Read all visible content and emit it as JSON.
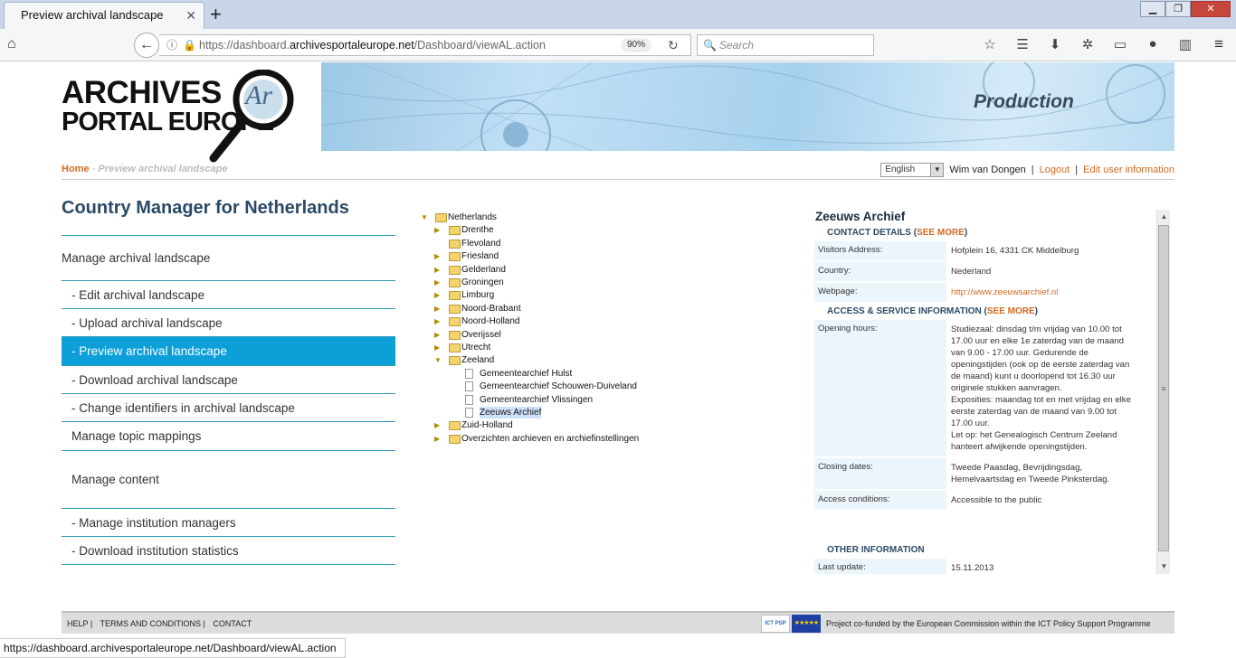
{
  "browser": {
    "tab_title": "Preview archival landscape",
    "tab_close": "✕",
    "new_tab": "+",
    "window_buttons": {
      "minimize": "▁",
      "restore": "❐",
      "close": "✕"
    },
    "url_prefix": "https://dashboard.",
    "url_domain": "archivesportaleurope.net",
    "url_path": "/Dashboard/viewAL.action",
    "zoom": "90%",
    "search_placeholder": "Search",
    "status_url": "https://dashboard.archivesportaleurope.net/Dashboard/viewAL.action"
  },
  "header": {
    "logo_line1": "ARCHIVES",
    "logo_line2": "PORTAL EUROPE",
    "logo_emblem_text": "Ar",
    "banner_title": "Production"
  },
  "breadcrumb": {
    "home": "Home",
    "separator": "-",
    "current": "Preview archival landscape"
  },
  "userbar": {
    "language": "English",
    "user_name": "Wim van Dongen",
    "sep": "|",
    "logout": "Logout",
    "edit_user": "Edit user information"
  },
  "left": {
    "title": "Country Manager for Netherlands",
    "nav": [
      {
        "label": "Manage archival landscape",
        "kind": "header",
        "height": 50
      },
      {
        "label": "- Edit archival landscape",
        "kind": "item",
        "height": 31
      },
      {
        "label": "- Upload archival landscape",
        "kind": "item",
        "height": 31
      },
      {
        "label": "- Preview archival landscape",
        "kind": "active",
        "height": 32
      },
      {
        "label": "- Download archival landscape",
        "kind": "item",
        "height": 31
      },
      {
        "label": "- Change identifiers in archival landscape",
        "kind": "item",
        "height": 31
      },
      {
        "label": "Manage topic mappings",
        "kind": "item",
        "height": 32
      },
      {
        "label": "Manage content",
        "kind": "item",
        "height": 64
      },
      {
        "label": "- Manage institution managers",
        "kind": "item",
        "height": 31
      },
      {
        "label": "- Download institution statistics",
        "kind": "item",
        "height": 32
      }
    ]
  },
  "tree": {
    "nodes": [
      {
        "label": "Netherlands",
        "type": "folder",
        "level": 0,
        "expanded": true
      },
      {
        "label": "Drenthe",
        "type": "folder",
        "level": 1,
        "expanded": false
      },
      {
        "label": "Flevoland",
        "type": "folder",
        "level": 1,
        "expanded": null
      },
      {
        "label": "Friesland",
        "type": "folder",
        "level": 1,
        "expanded": false
      },
      {
        "label": "Gelderland",
        "type": "folder",
        "level": 1,
        "expanded": false
      },
      {
        "label": "Groningen",
        "type": "folder",
        "level": 1,
        "expanded": false
      },
      {
        "label": "Limburg",
        "type": "folder",
        "level": 1,
        "expanded": false
      },
      {
        "label": "Noord-Brabant",
        "type": "folder",
        "level": 1,
        "expanded": false
      },
      {
        "label": "Noord-Holland",
        "type": "folder",
        "level": 1,
        "expanded": false
      },
      {
        "label": "Overijssel",
        "type": "folder",
        "level": 1,
        "expanded": false
      },
      {
        "label": "Utrecht",
        "type": "folder",
        "level": 1,
        "expanded": false
      },
      {
        "label": "Zeeland",
        "type": "folder",
        "level": 1,
        "expanded": true
      },
      {
        "label": "Gemeentearchief Hulst",
        "type": "doc",
        "level": 2
      },
      {
        "label": "Gemeentearchief Schouwen-Duiveland",
        "type": "doc",
        "level": 2
      },
      {
        "label": "Gemeentearchief Vlissingen",
        "type": "doc",
        "level": 2
      },
      {
        "label": "Zeeuws Archief",
        "type": "doc",
        "level": 2,
        "selected": true
      },
      {
        "label": "Zuid-Holland",
        "type": "folder",
        "level": 1,
        "expanded": false
      },
      {
        "label": "Overzichten archieven en archiefinstellingen",
        "type": "folder",
        "level": 1,
        "expanded": false
      }
    ]
  },
  "detail": {
    "title": "Zeeuws Archief",
    "contact_heading": "CONTACT DETAILS",
    "see_more": "SEE MORE",
    "contact_rows": [
      {
        "key": "Visitors Address:",
        "value": "Hofplein 16, 4331 CK Middelburg",
        "link": false
      },
      {
        "key": "Country:",
        "value": "Nederland",
        "link": false
      },
      {
        "key": "Webpage:",
        "value": "http://www.zeeuwsarchief.nl",
        "link": true
      }
    ],
    "access_heading": "ACCESS & SERVICE INFORMATION",
    "access_rows": [
      {
        "key": "Opening hours:",
        "value": "Studiezaal: dinsdag t/m vrijdag van 10.00 tot 17.00 uur en elke 1e zaterdag van de maand van 9.00 - 17.00 uur. Gedurende de openingstijden (ook op de eerste zaterdag van de maand) kunt u doorlopend tot 16.30 uur originele stukken aanvragen.\nExposities: maandag tot en met vrijdag en elke eerste zaterdag van de maand van 9.00 tot 17.00 uur.\nLet op: het Genealogisch Centrum Zeeland hanteert afwijkende openingstijden."
      },
      {
        "key": "Closing dates:",
        "value": "Tweede Paasdag, Bevrijdingsdag, Hemelvaartsdag en Tweede Pinksterdag."
      },
      {
        "key": "Access conditions:",
        "value": "Accessible to the public"
      }
    ],
    "other_heading": "OTHER INFORMATION",
    "other_rows": [
      {
        "key": "Last update:",
        "value": "15.11.2013"
      }
    ]
  },
  "footer": {
    "links": [
      "HELP |",
      "TERMS AND CONDITIONS |",
      "CONTACT"
    ],
    "ict_logo": "ICT PSP",
    "eu_flag": "★★★★★",
    "funding_text": "Project co-funded by the European Commission within the ICT Policy Support Programme"
  },
  "icons": {
    "home": "⌂",
    "back": "←",
    "info": "ⓘ",
    "lock": "🔒",
    "reload": "↻",
    "search": "🔍",
    "toolbar": [
      "☆",
      "☰",
      "⬇",
      "✲",
      "▭",
      "●",
      "▥"
    ],
    "menu": "≡",
    "scroll_up": "▲",
    "scroll_down": "▼",
    "scroll_grip": "≡",
    "select_arrow": "▼"
  },
  "colors": {
    "accent_blue": "#0c9fd8",
    "link_orange": "#d3691f",
    "title_blue": "#2a4a66"
  }
}
